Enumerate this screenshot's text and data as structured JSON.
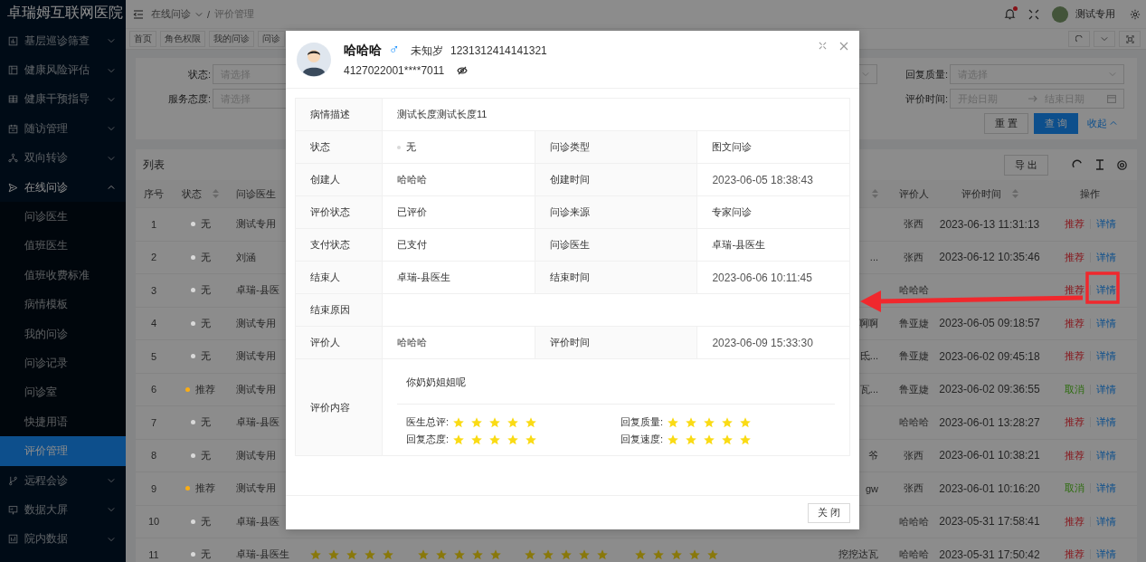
{
  "sidebar": {
    "title": "卓瑞姆互联网医院",
    "items": [
      {
        "label": "基层巡诊筛查",
        "expanded": false
      },
      {
        "label": "健康风险评估",
        "expanded": false
      },
      {
        "label": "健康干预指导",
        "expanded": false
      },
      {
        "label": "随访管理",
        "expanded": false
      },
      {
        "label": "双向转诊",
        "expanded": false
      },
      {
        "label": "在线问诊",
        "expanded": true,
        "children": [
          {
            "label": "问诊医生",
            "selected": false
          },
          {
            "label": "值班医生",
            "selected": false
          },
          {
            "label": "值班收费标准",
            "selected": false
          },
          {
            "label": "病情模板",
            "selected": false
          },
          {
            "label": "我的问诊",
            "selected": false
          },
          {
            "label": "问诊记录",
            "selected": false
          },
          {
            "label": "问诊室",
            "selected": false
          },
          {
            "label": "快捷用语",
            "selected": false
          },
          {
            "label": "评价管理",
            "selected": true
          }
        ]
      },
      {
        "label": "远程会诊",
        "expanded": false
      },
      {
        "label": "数据大屏",
        "expanded": false
      },
      {
        "label": "院内数据",
        "expanded": false
      }
    ]
  },
  "header": {
    "breadcrumb": [
      {
        "label": "在线问诊",
        "has_menu": true
      },
      {
        "label": "评价管理",
        "has_menu": false
      }
    ],
    "separator": "/",
    "notification_unread": true,
    "user": "测试专用"
  },
  "tabs": [
    {
      "label": "首页",
      "selected": false
    },
    {
      "label": "角色权限",
      "selected": false
    },
    {
      "label": "我的问诊",
      "selected": false
    },
    {
      "label": "问诊",
      "selected": false
    }
  ],
  "filters": {
    "left": [
      {
        "kind": "select",
        "label": "状态:",
        "placeholder": "请选择"
      },
      {
        "kind": "select",
        "label": "服务态度:",
        "placeholder": "请选择"
      }
    ],
    "right": [
      {
        "kind": "select",
        "label": "回复质量:",
        "placeholder": "请选择"
      },
      {
        "kind": "range",
        "label": "评价时间:",
        "start_placeholder": "开始日期",
        "end_placeholder": "结束日期"
      }
    ],
    "buttons": [
      {
        "kind": "default",
        "label": "重 置"
      },
      {
        "kind": "primary",
        "label": "查 询"
      },
      {
        "kind": "link",
        "label": "收起"
      }
    ]
  },
  "list": {
    "title": "列表",
    "export": "导 出",
    "columns": [
      {
        "label": "序号",
        "sortable": false
      },
      {
        "label": "状态",
        "sortable": true
      },
      {
        "label": "问诊医生",
        "sortable": false
      },
      {
        "sortable": true
      },
      {
        "label": "评价人",
        "sortable": false
      },
      {
        "label": "评价时间",
        "sortable": true
      },
      {
        "label": "操作",
        "sortable": false
      }
    ],
    "rows": [
      {
        "index": "1",
        "status": {
          "label": "无",
          "color": "#d9d9d9"
        },
        "doctor": "测试专用",
        "evaluator": "张西",
        "time": "2023-06-13 11:31:13",
        "actions": [
          {
            "kind": "recommend",
            "label": "推荐"
          },
          {
            "kind": "detail",
            "label": "详情"
          }
        ]
      },
      {
        "index": "2",
        "status": {
          "label": "无",
          "color": "#d9d9d9"
        },
        "doctor": "刘涵",
        "column_8": "...",
        "evaluator": "张西",
        "time": "2023-06-12 10:35:46",
        "actions": [
          {
            "kind": "recommend",
            "label": "推荐"
          },
          {
            "kind": "detail",
            "label": "详情"
          }
        ]
      },
      {
        "index": "3",
        "status": {
          "label": "无",
          "color": "#d9d9d9"
        },
        "doctor": "卓瑞-县医",
        "evaluator": "哈哈哈",
        "actions": [
          {
            "kind": "recommend",
            "label": "推荐"
          },
          {
            "kind": "detail",
            "label": "详情"
          }
        ]
      },
      {
        "index": "4",
        "status": {
          "label": "无",
          "color": "#d9d9d9"
        },
        "doctor": "测试专用",
        "column_8": "啊啊",
        "evaluator": "鲁亚婕",
        "time": "2023-06-05 09:18:57",
        "actions": [
          {
            "kind": "recommend",
            "label": "推荐"
          },
          {
            "kind": "detail",
            "label": "详情"
          }
        ]
      },
      {
        "index": "5",
        "status": {
          "label": "无",
          "color": "#d9d9d9"
        },
        "doctor": "测试专用",
        "column_8": "氐...",
        "evaluator": "鲁亚婕",
        "time": "2023-06-02 09:45:18",
        "actions": [
          {
            "kind": "recommend",
            "label": "推荐"
          },
          {
            "kind": "detail",
            "label": "详情"
          }
        ]
      },
      {
        "index": "6",
        "status": {
          "label": "推荐",
          "color": "#faad14"
        },
        "doctor": "测试专用",
        "column_8": "瓦...",
        "evaluator": "鲁亚婕",
        "time": "2023-06-02 09:36:55",
        "actions": [
          {
            "kind": "cancel",
            "label": "取消"
          },
          {
            "kind": "detail",
            "label": "详情"
          }
        ]
      },
      {
        "index": "7",
        "status": {
          "label": "无",
          "color": "#d9d9d9"
        },
        "doctor": "卓瑞-县医",
        "evaluator": "哈哈哈",
        "time": "2023-06-01 13:28:27",
        "actions": [
          {
            "kind": "recommend",
            "label": "推荐"
          },
          {
            "kind": "detail",
            "label": "详情"
          }
        ]
      },
      {
        "index": "8",
        "status": {
          "label": "无",
          "color": "#d9d9d9"
        },
        "doctor": "测试专用",
        "column_8": "爷",
        "evaluator": "张西",
        "time": "2023-06-01 10:38:21",
        "actions": [
          {
            "kind": "recommend",
            "label": "推荐"
          },
          {
            "kind": "detail",
            "label": "详情"
          }
        ]
      },
      {
        "index": "9",
        "status": {
          "label": "推荐",
          "color": "#faad14"
        },
        "doctor": "测试专用",
        "column_8": "gw",
        "evaluator": "张西",
        "time": "2023-06-01 10:16:20",
        "actions": [
          {
            "kind": "cancel",
            "label": "取消"
          },
          {
            "kind": "detail",
            "label": "详情"
          }
        ]
      },
      {
        "index": "10",
        "status": {
          "label": "无",
          "color": "#d9d9d9"
        },
        "doctor": "卓瑞-县医",
        "evaluator": "哈哈哈",
        "time": "2023-05-31 17:58:41",
        "actions": [
          {
            "kind": "recommend",
            "label": "推荐"
          },
          {
            "kind": "detail",
            "label": "详情"
          }
        ]
      },
      {
        "index": "11",
        "status": {
          "label": "无",
          "color": "#d9d9d9"
        },
        "doctor": "卓瑞-县医生",
        "ratings": [
          {
            "stars": 5
          },
          {
            "stars": 5
          },
          {
            "stars": 5
          },
          {
            "stars": 5
          }
        ],
        "column_8": "挖挖达瓦",
        "evaluator": "哈哈哈",
        "time": "2023-05-31 17:50:42",
        "actions": [
          {
            "kind": "recommend",
            "label": "推荐"
          },
          {
            "kind": "detail",
            "label": "详情"
          }
        ]
      }
    ]
  },
  "modal": {
    "name": "哈哈哈",
    "gender": "♂",
    "age": "未知岁",
    "number": "1231312414141321",
    "id_number": "4127022001****7011",
    "details": [
      [
        {
          "label": "病情描述",
          "value": "测试长度测试长度11"
        }
      ],
      [
        {
          "label": "状态",
          "value": "无",
          "color": "#d9d9d9"
        },
        {
          "label": "问诊类型",
          "value": "图文问诊"
        }
      ],
      [
        {
          "label": "创建人",
          "value": "哈哈哈"
        },
        {
          "label": "创建时间",
          "value": "2023-06-05 18:38:43"
        }
      ],
      [
        {
          "label": "评价状态",
          "value": "已评价"
        },
        {
          "label": "问诊来源",
          "value": "专家问诊"
        }
      ],
      [
        {
          "label": "支付状态",
          "value": "已支付"
        },
        {
          "label": "问诊医生",
          "value": "卓瑞-县医生"
        }
      ],
      [
        {
          "label": "结束人",
          "value": "卓瑞-县医生"
        },
        {
          "label": "结束时间",
          "value": "2023-06-06 10:11:45"
        }
      ],
      [
        {
          "label": "结束原因"
        }
      ],
      [
        {
          "label": "评价人",
          "value": "哈哈哈"
        },
        {
          "label": "评价时间",
          "value": "2023-06-09 15:33:30"
        }
      ]
    ],
    "review": {
      "label": "评价内容",
      "comment": "你奶奶姐姐呢",
      "ratings": [
        {
          "label": "医生总评:",
          "stars": 5
        },
        {
          "label": "回复质量:",
          "stars": 5
        },
        {
          "label": "回复态度:",
          "stars": 5
        },
        {
          "label": "回复速度:",
          "stars": 5
        }
      ]
    },
    "close": "关 闭"
  }
}
